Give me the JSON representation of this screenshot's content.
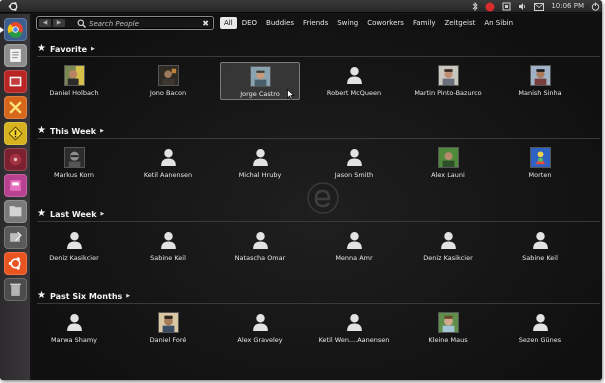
{
  "tray": {
    "clock": "10:06 PM"
  },
  "search": {
    "placeholder": "Search People",
    "clear": "✖"
  },
  "nav": {
    "back": "◀",
    "forward": "▶"
  },
  "filters": [
    "All",
    "DEO",
    "Buddies",
    "Friends",
    "Swing",
    "Coworkers",
    "Family",
    "Zeitgeist",
    "An Sibin"
  ],
  "groups": [
    {
      "title": "Favorite",
      "people": [
        "Daniel Holbach",
        "Jono Bacon",
        "Jorge Castro",
        "Robert McQueen",
        "Martin Pinto-Bazurco",
        "Manish Sinha"
      ]
    },
    {
      "title": "This Week",
      "people": [
        "Markus Korn",
        "Ketil Aanensen",
        "Michal Hruby",
        "Jason Smith",
        "Alex Launi",
        "Morten"
      ]
    },
    {
      "title": "Last Week",
      "people": [
        "Deniz Kasikcier",
        "Sabine Keil",
        "Natascha Omar",
        "Menna Amr",
        "Deniz Kasikcier",
        "Sabine Keil"
      ]
    },
    {
      "title": "Past Six Months",
      "people": [
        "Marwa Shamy",
        "Daniel Foré",
        "Alex Graveley",
        "Ketil Wen....Aanensen",
        "Kleine Maus",
        "Sezen Günes"
      ]
    }
  ],
  "colors": {
    "accent_orange": "#e95420",
    "selection": "#ffffff"
  }
}
